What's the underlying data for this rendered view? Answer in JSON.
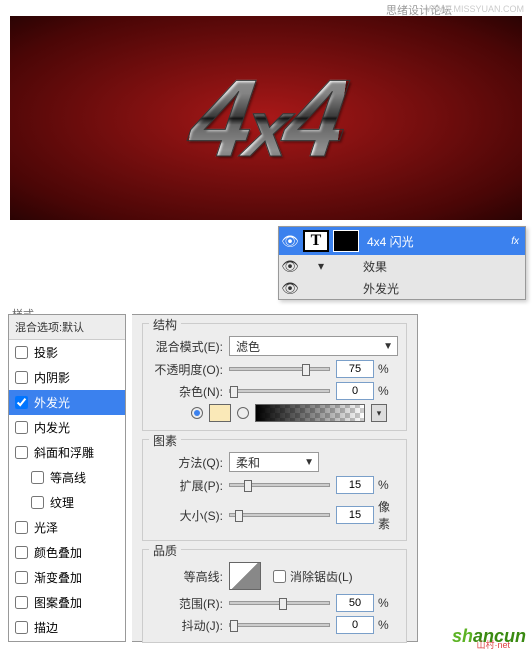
{
  "header": {
    "forum": "思绪设计论坛",
    "url": "WWW.MISSYUAN.COM"
  },
  "preview": {
    "text_4x4": "4x4"
  },
  "layers": {
    "name": "4x4 闪光",
    "fx": "fx",
    "effects_label": "效果",
    "outer_glow_label": "外发光",
    "toggle": "▾"
  },
  "style_list": {
    "title_bar": "样式",
    "header": "混合选项:默认",
    "items": [
      {
        "label": "投影",
        "checked": false,
        "selected": false
      },
      {
        "label": "内阴影",
        "checked": false,
        "selected": false
      },
      {
        "label": "外发光",
        "checked": true,
        "selected": true
      },
      {
        "label": "内发光",
        "checked": false,
        "selected": false
      },
      {
        "label": "斜面和浮雕",
        "checked": false,
        "selected": false
      },
      {
        "label": "等高线",
        "checked": false,
        "selected": false,
        "indent": true
      },
      {
        "label": "纹理",
        "checked": false,
        "selected": false,
        "indent": true
      },
      {
        "label": "光泽",
        "checked": false,
        "selected": false
      },
      {
        "label": "颜色叠加",
        "checked": false,
        "selected": false
      },
      {
        "label": "渐变叠加",
        "checked": false,
        "selected": false
      },
      {
        "label": "图案叠加",
        "checked": false,
        "selected": false
      },
      {
        "label": "描边",
        "checked": false,
        "selected": false
      }
    ]
  },
  "structure": {
    "title": "结构",
    "blend_mode_label": "混合模式(E):",
    "blend_mode_value": "滤色",
    "opacity_label": "不透明度(O):",
    "opacity_value": "75",
    "noise_label": "杂色(N):",
    "noise_value": "0",
    "percent": "%",
    "solid_color": "#fae9b8"
  },
  "elements": {
    "title": "图素",
    "technique_label": "方法(Q):",
    "technique_value": "柔和",
    "spread_label": "扩展(P):",
    "spread_value": "15",
    "size_label": "大小(S):",
    "size_value": "15",
    "percent": "%",
    "pixel": "像素"
  },
  "quality": {
    "title": "品质",
    "contour_label": "等高线:",
    "antialias_label": "消除锯齿(L)",
    "range_label": "范围(R):",
    "range_value": "50",
    "jitter_label": "抖动(J):",
    "jitter_value": "0",
    "percent": "%"
  },
  "watermark": {
    "brand": "shancun",
    "sub": "山村·net"
  }
}
